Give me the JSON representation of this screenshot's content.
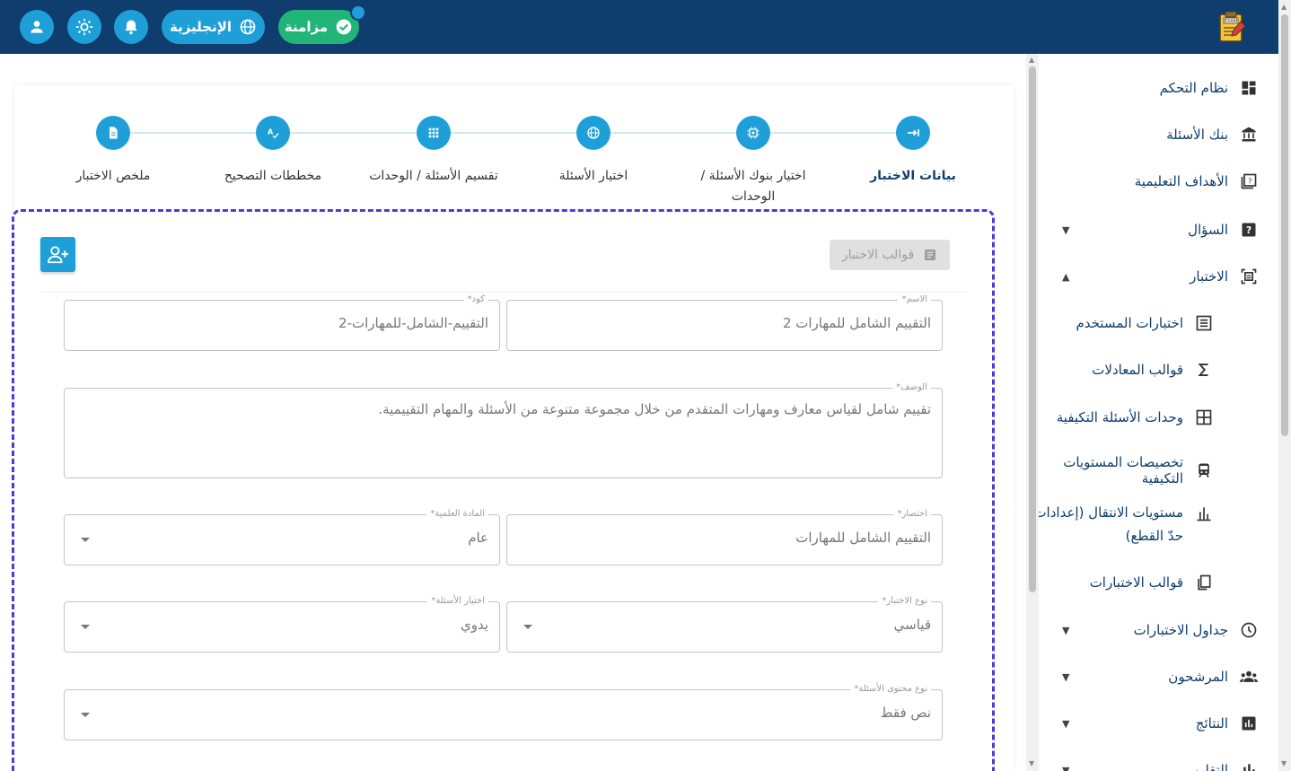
{
  "header": {
    "sync_label": "مزامنة",
    "language_label": "الإنجليزية",
    "logo_text": "EXAM"
  },
  "sidebar": {
    "items": [
      {
        "label": "نظام التحكم",
        "icon": "dashboard-icon"
      },
      {
        "label": "بنك الأسئلة",
        "icon": "bank-icon"
      },
      {
        "label": "الأهداف التعليمية",
        "icon": "learning-objectives-icon"
      },
      {
        "label": "السؤال",
        "icon": "question-icon",
        "expanded": false
      },
      {
        "label": "الاختبار",
        "icon": "exam-icon",
        "expanded": true
      },
      {
        "label": "اختبارات المستخدم",
        "icon": "list-icon"
      },
      {
        "label": "قوالب المعادلات",
        "icon": "sigma-icon"
      },
      {
        "label": "وحدات الأسئلة التكيفية",
        "icon": "grid-icon"
      },
      {
        "label": "تخصيصات المستويات التكيفية",
        "icon": "train-icon"
      },
      {
        "label": "مستويات الانتقال (إعدادات حدّ القطع)",
        "icon": "bar-chart-icon"
      },
      {
        "label": "قوالب الاختبارات",
        "icon": "copy-icon"
      },
      {
        "label": "جداول الاختبارات",
        "icon": "clock-icon",
        "expanded": false
      },
      {
        "label": "المرشحون",
        "icon": "people-icon",
        "expanded": false
      },
      {
        "label": "النتائج",
        "icon": "results-icon",
        "expanded": false
      },
      {
        "label": "التقارير",
        "icon": "report-icon",
        "expanded": false
      }
    ]
  },
  "stepper": {
    "steps": [
      {
        "label": "بيانات الاختبار",
        "icon": "arrow-right-bar-icon",
        "active": true
      },
      {
        "label": "اختيار بنوك الأسئلة / الوحدات",
        "icon": "chip-icon",
        "active": false
      },
      {
        "label": "اختيار الأسئلة",
        "icon": "globe-icon",
        "active": false
      },
      {
        "label": "تقسيم الأسئلة / الوحدات",
        "icon": "apps-icon",
        "active": false
      },
      {
        "label": "مخططات التصحيح",
        "icon": "spellcheck-icon",
        "active": false
      },
      {
        "label": "ملخص الاختبار",
        "icon": "document-icon",
        "active": false
      }
    ]
  },
  "form": {
    "templates_button": "قوالب الاختبار",
    "name": {
      "label": "الاسم*",
      "value": "التقييم الشامل للمهارات 2"
    },
    "code": {
      "label": "كود*",
      "value": "التقييم-الشامل-للمهارات-2"
    },
    "description": {
      "label": "الوصف*",
      "value": "تقييم شامل لقياس معارف ومهارات المتقدم من خلال مجموعة متنوعة من الأسئلة والمهام التقييمية."
    },
    "abbreviation": {
      "label": "اختصار*",
      "value": "التقييم الشامل للمهارات"
    },
    "subject": {
      "label": "المادة العلمية*",
      "value": "عام"
    },
    "exam_type": {
      "label": "نوع الاختبار*",
      "value": "قياسي"
    },
    "question_selection": {
      "label": "اختيار الأسئلة*",
      "value": "يدوي"
    },
    "content_type": {
      "label": "نوع محتوى الأسئلة*",
      "value": "نص فقط"
    }
  },
  "colors": {
    "header_bg": "#0f3d6e",
    "accent": "#1f9fd8",
    "sync": "#21b57a",
    "panel_border": "#4a3dd6"
  }
}
